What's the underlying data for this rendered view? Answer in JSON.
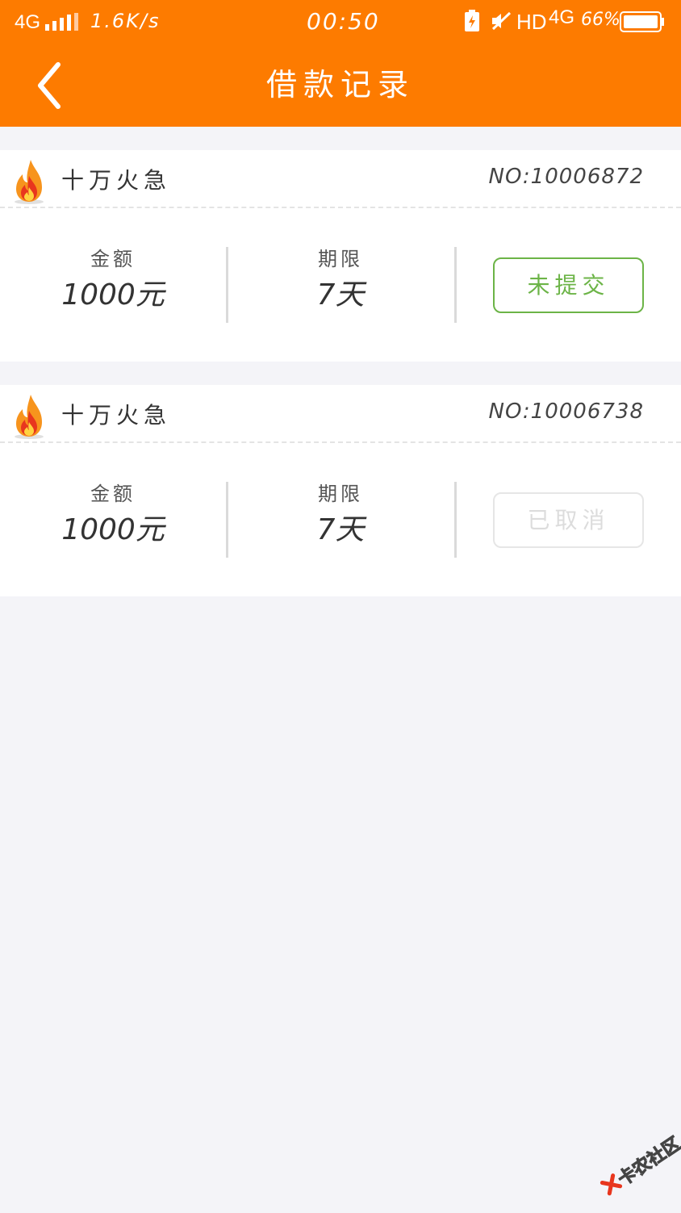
{
  "status_bar": {
    "network": "4G",
    "speed": "1.6K/s",
    "time": "00:50",
    "hd": "HD",
    "network_2": "4G",
    "battery_percent": "66%"
  },
  "header": {
    "title": "借款记录"
  },
  "records": [
    {
      "product_name": "十万火急",
      "order_no": "NO:10006872",
      "amount_label": "金额",
      "amount_value": "1000元",
      "term_label": "期限",
      "term_value": "7天",
      "status_label": "未提交",
      "status_color": "#6cb447"
    },
    {
      "product_name": "十万火急",
      "order_no": "NO:10006738",
      "amount_label": "金额",
      "amount_value": "1000元",
      "term_label": "期限",
      "term_value": "7天",
      "status_label": "已取消",
      "status_color": "#dcdcdc"
    }
  ],
  "theme": {
    "header_bg": "#fd7b00",
    "page_bg": "#f4f4f8"
  },
  "icons": {
    "back": "back-arrow-icon",
    "product": "fire-icon",
    "watermark": "kanong-logo"
  },
  "watermark": {
    "text": "卡农社区"
  }
}
